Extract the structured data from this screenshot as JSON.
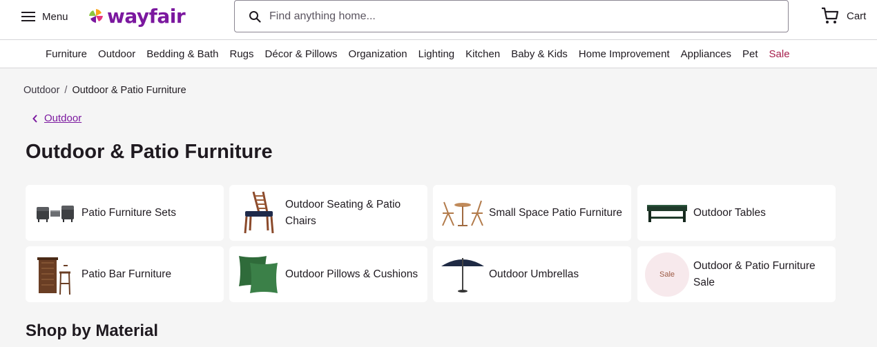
{
  "header": {
    "menu_label": "Menu",
    "logo_text": "wayfair",
    "search_placeholder": "Find anything home...",
    "cart_label": "Cart",
    "brand_color": "#7b189f"
  },
  "category_nav": [
    {
      "label": "Furniture"
    },
    {
      "label": "Outdoor"
    },
    {
      "label": "Bedding & Bath"
    },
    {
      "label": "Rugs"
    },
    {
      "label": "Décor & Pillows"
    },
    {
      "label": "Organization"
    },
    {
      "label": "Lighting"
    },
    {
      "label": "Kitchen"
    },
    {
      "label": "Baby & Kids"
    },
    {
      "label": "Home Improvement"
    },
    {
      "label": "Appliances"
    },
    {
      "label": "Pet"
    },
    {
      "label": "Sale"
    }
  ],
  "breadcrumb": {
    "parent": "Outdoor",
    "separator": "/",
    "current": "Outdoor & Patio Furniture"
  },
  "back_link": "Outdoor",
  "page_title": "Outdoor & Patio Furniture",
  "categories": [
    {
      "label": "Patio Furniture Sets",
      "icon": "patio-sets-icon"
    },
    {
      "label": "Outdoor Seating & Patio Chairs",
      "icon": "patio-chair-icon"
    },
    {
      "label": "Small Space Patio Furniture",
      "icon": "bistro-set-icon"
    },
    {
      "label": "Outdoor Tables",
      "icon": "outdoor-table-icon"
    },
    {
      "label": "Patio Bar Furniture",
      "icon": "bar-set-icon"
    },
    {
      "label": "Outdoor Pillows & Cushions",
      "icon": "pillows-icon"
    },
    {
      "label": "Outdoor Umbrellas",
      "icon": "umbrella-icon"
    },
    {
      "label": "Outdoor & Patio Furniture Sale",
      "icon": "sale-badge",
      "badge": "Sale"
    }
  ],
  "section_title": "Shop by Material"
}
